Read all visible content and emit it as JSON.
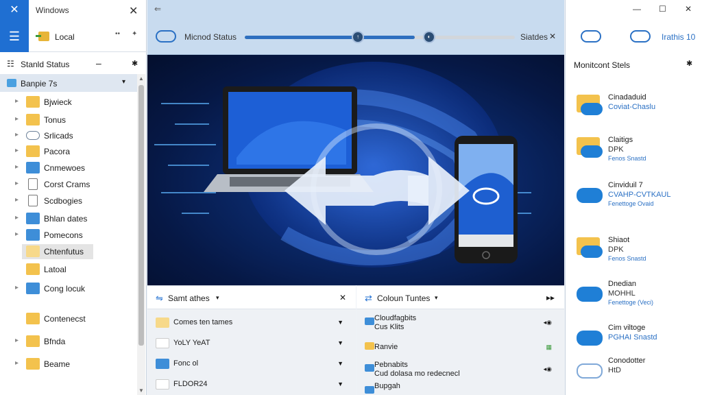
{
  "left": {
    "close_icon": "✕",
    "title": "Windows",
    "close_x": "✕",
    "menu_icon": "☰",
    "local_label": "Local",
    "dots": "••",
    "pin": "✦",
    "status_label": "Stanld Status",
    "status_dash": "–",
    "status_pin": "✱",
    "selected_label": "Banpie 7s",
    "selected_chev": "▾",
    "tree": [
      {
        "label": "Bjwieck"
      },
      {
        "label": "Tonus"
      },
      {
        "label": "Srlicads"
      },
      {
        "label": "Pacora"
      },
      {
        "label": "Cnmewoes"
      },
      {
        "label": "Corst Crams"
      },
      {
        "label": "Scdbogies"
      },
      {
        "label": "Bhlan dates"
      },
      {
        "label": "Pomecons"
      },
      {
        "label": "Chtenfutus"
      },
      {
        "label": "Latoal"
      },
      {
        "label": "Cong locuk"
      },
      {
        "label": "Contenecst"
      },
      {
        "label": "Bfnda"
      },
      {
        "label": "Beame"
      }
    ]
  },
  "center": {
    "back": "⇐",
    "title": "Micnod Status",
    "progress": 0.63,
    "knob1": "↑",
    "knob2": "◐",
    "right_label": "Siatdes",
    "close": "✕",
    "panel1": {
      "title": "Samt athes",
      "chev": "▾",
      "close": "✕",
      "rows": [
        {
          "label": "Comes ten tames"
        },
        {
          "label": "YoLY YeAT"
        },
        {
          "label": "Fonc ol"
        },
        {
          "label": "FLDOR24"
        }
      ]
    },
    "panel2": {
      "title": "Coloun Tuntes",
      "chev": "▾",
      "pin": "▸▸",
      "rows": [
        {
          "label1": "Cloudfagbits",
          "label2": "Cus Klits"
        },
        {
          "label1": "Ranvie",
          "label2": ""
        },
        {
          "label1": "Pebnabits",
          "label2": "Cud dolasa mo redecnecl"
        },
        {
          "label1": "Bupgah",
          "label2": ""
        }
      ]
    }
  },
  "right": {
    "min": "—",
    "max": "☐",
    "close": "✕",
    "top_label": "Irathis 10",
    "section_title": "Monitcont Stels",
    "section_pin": "✱",
    "items": [
      {
        "t1": "Cinadaduid",
        "t2": "Coviat-Chaslu",
        "t3": ""
      },
      {
        "t1": "Claitigs",
        "t2": "DPK",
        "t3": "Fenos Snastd"
      },
      {
        "t1": "Cinviduil 7",
        "t2": "CVAHP-CVTKAUL",
        "t3": "Fenettoge Ovaid"
      },
      {
        "t1": "Shiaot",
        "t2": "DPK",
        "t3": "Fenos Snastd"
      },
      {
        "t1": "Dnedian",
        "t2": "MOHHL",
        "t3": "Fenettoge (Veci)"
      },
      {
        "t1": "Cim viltoge",
        "t2": "PGHAI Snastd",
        "t3": ""
      },
      {
        "t1": "Conodotter",
        "t2": "HtD",
        "t3": ""
      }
    ]
  }
}
